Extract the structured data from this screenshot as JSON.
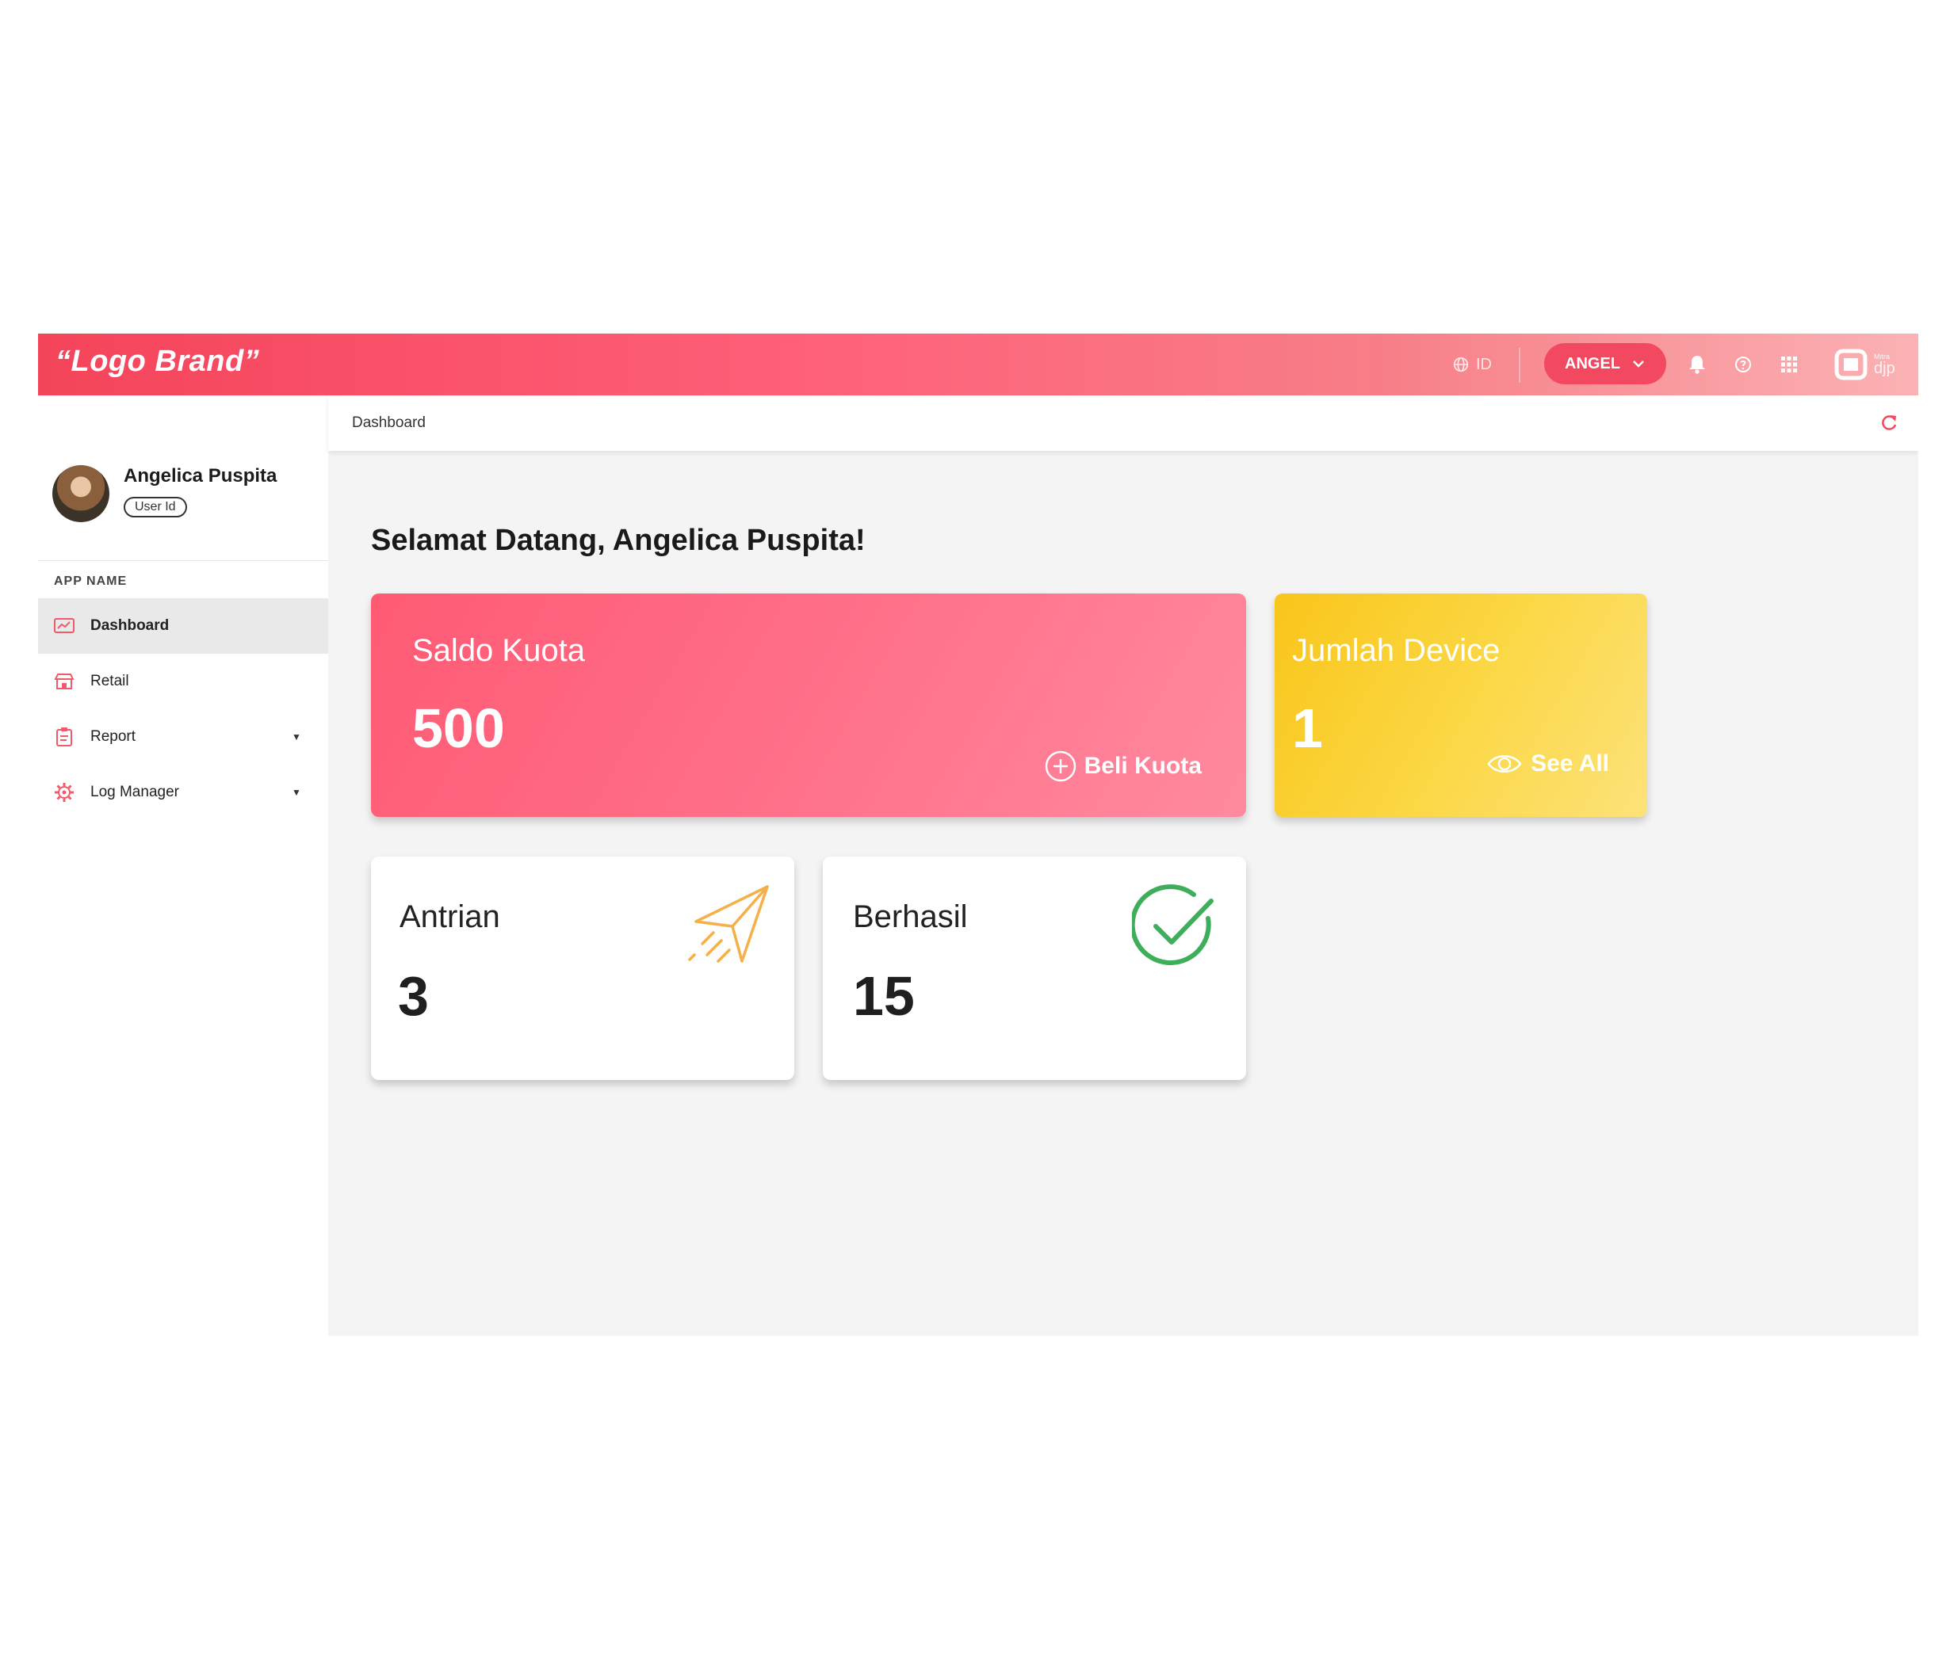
{
  "topbar": {
    "brand": "“Logo Brand”",
    "language": "ID",
    "user_menu": "ANGEL",
    "logo_small": "Mitra",
    "logo_big": "djp"
  },
  "sidebar": {
    "profile": {
      "name": "Angelica Puspita",
      "user_id": "User Id"
    },
    "section_title": "APP NAME",
    "items": [
      {
        "label": "Dashboard",
        "icon": "dashboard-icon",
        "active": true
      },
      {
        "label": "Retail",
        "icon": "store-icon"
      },
      {
        "label": "Report",
        "icon": "clipboard-icon",
        "expandable": true
      },
      {
        "label": "Log Manager",
        "icon": "gear-log-icon",
        "expandable": true
      }
    ]
  },
  "breadcrumb": "Dashboard",
  "main": {
    "welcome": "Selamat Datang, Angelica Puspita!",
    "cards": {
      "saldo": {
        "title": "Saldo Kuota",
        "value": "500",
        "action": "Beli Kuota"
      },
      "device": {
        "title": "Jumlah Device",
        "value": "1",
        "action": "See All"
      },
      "antrian": {
        "title": "Antrian",
        "value": "3"
      },
      "berhasil": {
        "title": "Berhasil",
        "value": "15"
      }
    }
  },
  "colors": {
    "primary": "#ff5a74",
    "accent_yellow": "#f9c51a",
    "success_green": "#3fae5a",
    "send_orange": "#f5b04a"
  }
}
